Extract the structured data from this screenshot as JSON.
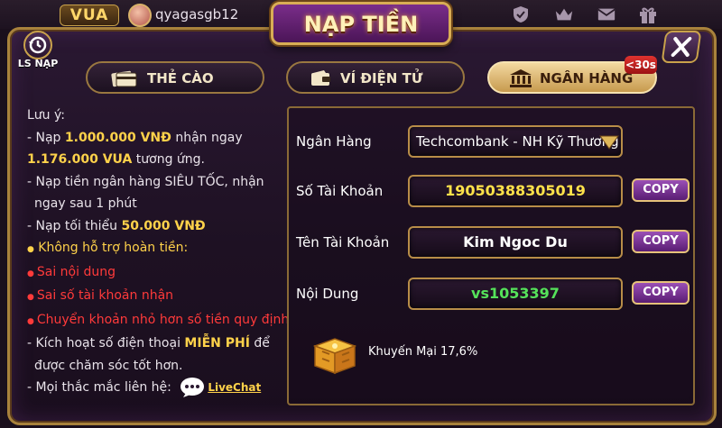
{
  "topbar": {
    "vip_badge": "VUA",
    "username": "qyagasgb12",
    "icons": [
      "shield-icon",
      "crown-icon",
      "mail-icon",
      "gift-icon"
    ]
  },
  "dialog": {
    "title": "NẠP TIỀN",
    "history_label": "LS NẠP",
    "close_icon": "close-icon"
  },
  "tabs": [
    {
      "label": "THẺ CÀO",
      "icon": "card-icon",
      "active": false
    },
    {
      "label": "VÍ ĐIỆN TỬ",
      "icon": "wallet-icon",
      "active": false
    },
    {
      "label": "NGÂN HÀNG",
      "icon": "bank-icon",
      "active": true,
      "badge": "<30s"
    }
  ],
  "notes": {
    "heading": "Lưu ý:",
    "l1_pre": "- Nạp ",
    "l1_amount": "1.000.000 VNĐ",
    "l1_post": " nhận ngay",
    "l2_amount": "1.176.000 VUA",
    "l2_post": " tương ứng.",
    "l3": "- Nạp tiền ngân hàng SIÊU TỐC, nhận",
    "l4": "ngay sau 1 phút",
    "l5_pre": "- Nạp tối thiểu ",
    "l5_amount": "50.000 VNĐ",
    "l6_bullet": "●",
    "l6": " Không hỗ trợ hoàn tiền:",
    "l7": "Sai nội dung",
    "l8": "Sai số tài khoản nhận",
    "l9": "Chuyển khoản nhỏ hơn số tiền quy định",
    "l10_pre": "- Kích hoạt số điện thoại ",
    "l10_free": "MIỄN PHÍ",
    "l10_post": " để",
    "l11": "được chăm sóc tốt hơn.",
    "l12": "- Mọi thắc mắc liên hệ:",
    "livechat": "LiveChat"
  },
  "form": {
    "bank_label": "Ngân Hàng",
    "bank_value": "Techcombank - NH Kỹ Thương",
    "account_label": "Số Tài Khoản",
    "account_value": "19050388305019",
    "name_label": "Tên Tài Khoản",
    "name_value": "Kim Ngoc Du",
    "content_label": "Nội Dung",
    "content_value": "vs1053397",
    "copy_label": "COPY"
  },
  "promo": {
    "text": "Khuyến Mại 17,6%",
    "icon": "treasure-box-icon"
  },
  "colors": {
    "accent_gold": "#c9a24b",
    "highlight_yellow": "#ffd24a",
    "warning_red": "#ff3a3a",
    "content_green": "#55e25a",
    "copy_purple": "#7a32a0"
  }
}
